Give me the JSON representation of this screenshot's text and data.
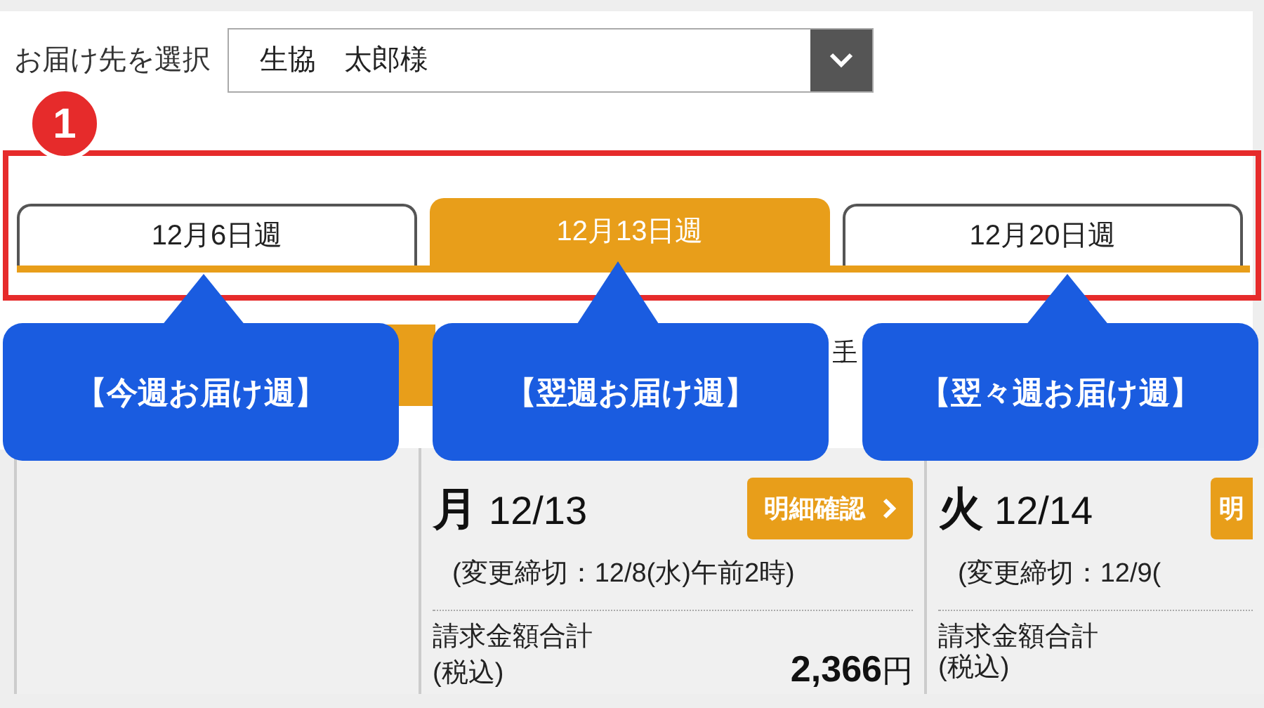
{
  "delivery_select": {
    "label": "お届け先を選択",
    "value": "生協　太郎様"
  },
  "badge": "1",
  "tabs": [
    {
      "label": "12月6日週",
      "selected": false
    },
    {
      "label": "12月13日週",
      "selected": true
    },
    {
      "label": "12月20日週",
      "selected": false
    }
  ],
  "callouts": [
    "【今週お届け週】",
    "【翌週お届け週】",
    "【翌々週お届け週】"
  ],
  "partial_link": "手",
  "days": [
    {
      "weekday": "月",
      "date": "12/13",
      "detail_button": "明細確認",
      "deadline": "(変更締切：12/8(水)午前2時)",
      "total_label": "請求金額合計",
      "tax_label": "(税込)",
      "amount": "2,366",
      "unit": "円"
    },
    {
      "weekday": "火",
      "date": "12/14",
      "detail_button": "明",
      "deadline": "(変更締切：12/9(",
      "total_label": "請求金額合計",
      "tax_label": "(税込)"
    }
  ]
}
